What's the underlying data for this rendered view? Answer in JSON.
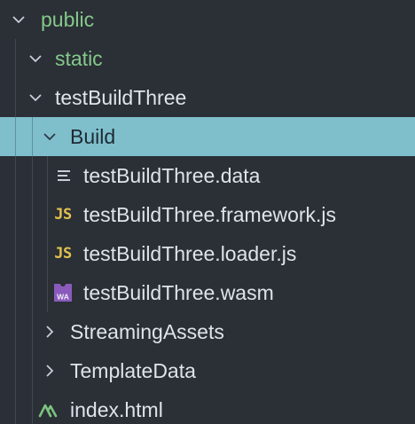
{
  "explorer": {
    "items": [
      {
        "label": "public",
        "icon": "chevron-down-icon",
        "expanded": true
      },
      {
        "label": "static",
        "icon": "chevron-down-icon",
        "expanded": true
      },
      {
        "label": "testBuildThree",
        "icon": "chevron-down-icon",
        "expanded": true
      },
      {
        "label": "Build",
        "icon": "chevron-down-icon",
        "expanded": true,
        "selected": true
      },
      {
        "label": "testBuildThree.data",
        "icon": "lines-icon"
      },
      {
        "label": "testBuildThree.framework.js",
        "icon": "js-icon",
        "icon_text": "JS"
      },
      {
        "label": "testBuildThree.loader.js",
        "icon": "js-icon",
        "icon_text": "JS"
      },
      {
        "label": "testBuildThree.wasm",
        "icon": "wasm-icon",
        "icon_text": "WA"
      },
      {
        "label": "StreamingAssets",
        "icon": "chevron-right-icon",
        "expanded": false
      },
      {
        "label": "TemplateData",
        "icon": "chevron-right-icon",
        "expanded": false
      },
      {
        "label": "index.html",
        "icon": "nuxt-logo-icon"
      }
    ]
  },
  "colors": {
    "background": "#2b2f36",
    "selected_background": "#7fbfcc",
    "folder_text_accent": "#84c98a",
    "text": "#dfe4ea",
    "js_icon": "#e2c24f",
    "wasm_icon": "#8a5bbd",
    "nuxt_icon": "#7bc47f"
  }
}
